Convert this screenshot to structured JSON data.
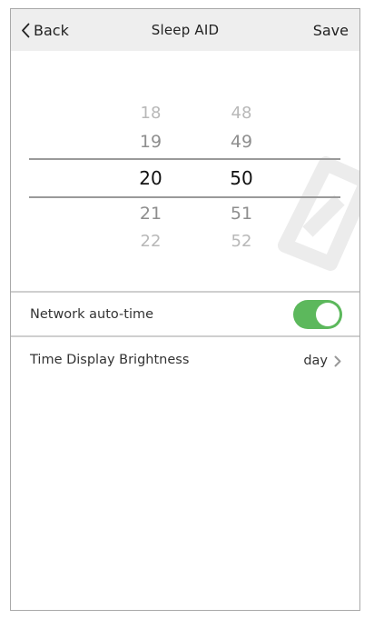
{
  "header": {
    "back_label": "Back",
    "title": "Sleep AID",
    "save_label": "Save"
  },
  "time_picker": {
    "hours": [
      "18",
      "19",
      "20",
      "21",
      "22"
    ],
    "minutes": [
      "48",
      "49",
      "50",
      "51",
      "52"
    ],
    "selected_hour": "20",
    "selected_minute": "50"
  },
  "settings": {
    "network_auto_time": {
      "label": "Network auto-time",
      "enabled": true
    },
    "brightness": {
      "label": "Time Display Brightness",
      "value": "day"
    }
  },
  "icons": {
    "back": "chevron-left-icon",
    "brightness_arrow": "chevron-right-icon"
  },
  "colors": {
    "toggle_on": "#5cb85c",
    "header_bg": "#eeeeee"
  }
}
